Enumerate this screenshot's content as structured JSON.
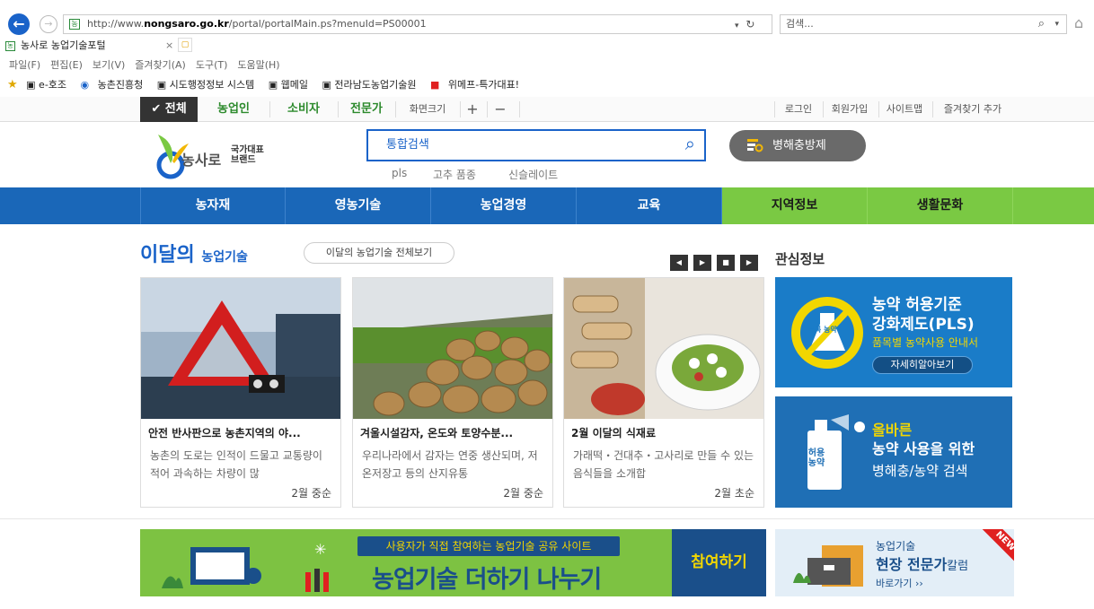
{
  "browser": {
    "url_prefix": "http://www.",
    "url_domain": "nongsaro.go.kr",
    "url_suffix": "/portal/portalMain.ps?menuId=PS00001",
    "search_placeholder": "검색...",
    "tab_title": "농사로 농업기술포털",
    "menu": "파일(F)  편집(E)  보기(V)  즐겨찾기(A)  도구(T)  도움말(H)",
    "favorites": [
      "e-호조",
      "농촌진흥청",
      "시도행정정보 시스템",
      "웹메일",
      "전라남도농업기술원",
      "위메프-특가대표!"
    ]
  },
  "topbar": {
    "all": "✔ 전체",
    "tabs": [
      "농업인",
      "소비자",
      "전문가"
    ],
    "font_size": "화면크기",
    "plus": "+",
    "minus": "−",
    "links": [
      "로그인",
      "회원가입",
      "사이트맵",
      "즐겨찾기 추가"
    ]
  },
  "header": {
    "logo_text": "농사로",
    "logo_badge_1": "국가대표",
    "logo_badge_2": "브랜드",
    "search_placeholder": "통합검색",
    "keywords": [
      "pls",
      "고추 품종",
      "신슬레이트"
    ],
    "pest_button": "병해충방제"
  },
  "gnb": [
    "농자재",
    "영농기술",
    "농업경영",
    "교육",
    "지역정보",
    "생활문화"
  ],
  "month": {
    "title_big": "이달의",
    "title_small": "농업기술",
    "view_all": "이달의 농업기술 전체보기",
    "interest": "관심정보",
    "cards": [
      {
        "title": "안전 반사판으로 농촌지역의 야...",
        "desc": "농촌의 도로는 인적이 드물고 교통량이 적어 과속하는 차량이 많",
        "date": "2월 중순"
      },
      {
        "title": "겨울시설감자, 온도와 토양수분...",
        "desc": "우리나라에서 감자는 연중 생산되며, 저온저장고 등의 산지유통",
        "date": "2월 중순"
      },
      {
        "title": "2월 이달의 식재료",
        "desc": "가래떡・건대추・고사리로 만들 수 있는 음식들을 소개합",
        "date": "2월 초순"
      }
    ]
  },
  "banners": {
    "pls_title_1": "농약 허용기준",
    "pls_title_2": "강화제도(PLS)",
    "pls_sub": "품목별 농약사용 안내서",
    "pls_btn": "자세히알아보기",
    "pls_badge": "미등록 농약",
    "pest_line1": "올바른",
    "pest_line2": "농약 사용을 위한",
    "pest_line3": "병해충/농약 검색",
    "pest_bottle": "허용 농약",
    "share_sub": "사용자가 직접 참여하는 농업기술 공유 사이트",
    "share_title": "농업기술 더하기 나누기",
    "share_btn": "참여하기",
    "expert_1": "농업기술",
    "expert_2": "현장 전문가",
    "expert_3": "칼럼",
    "expert_link": "바로가기 ››",
    "new_badge": "NEW"
  }
}
